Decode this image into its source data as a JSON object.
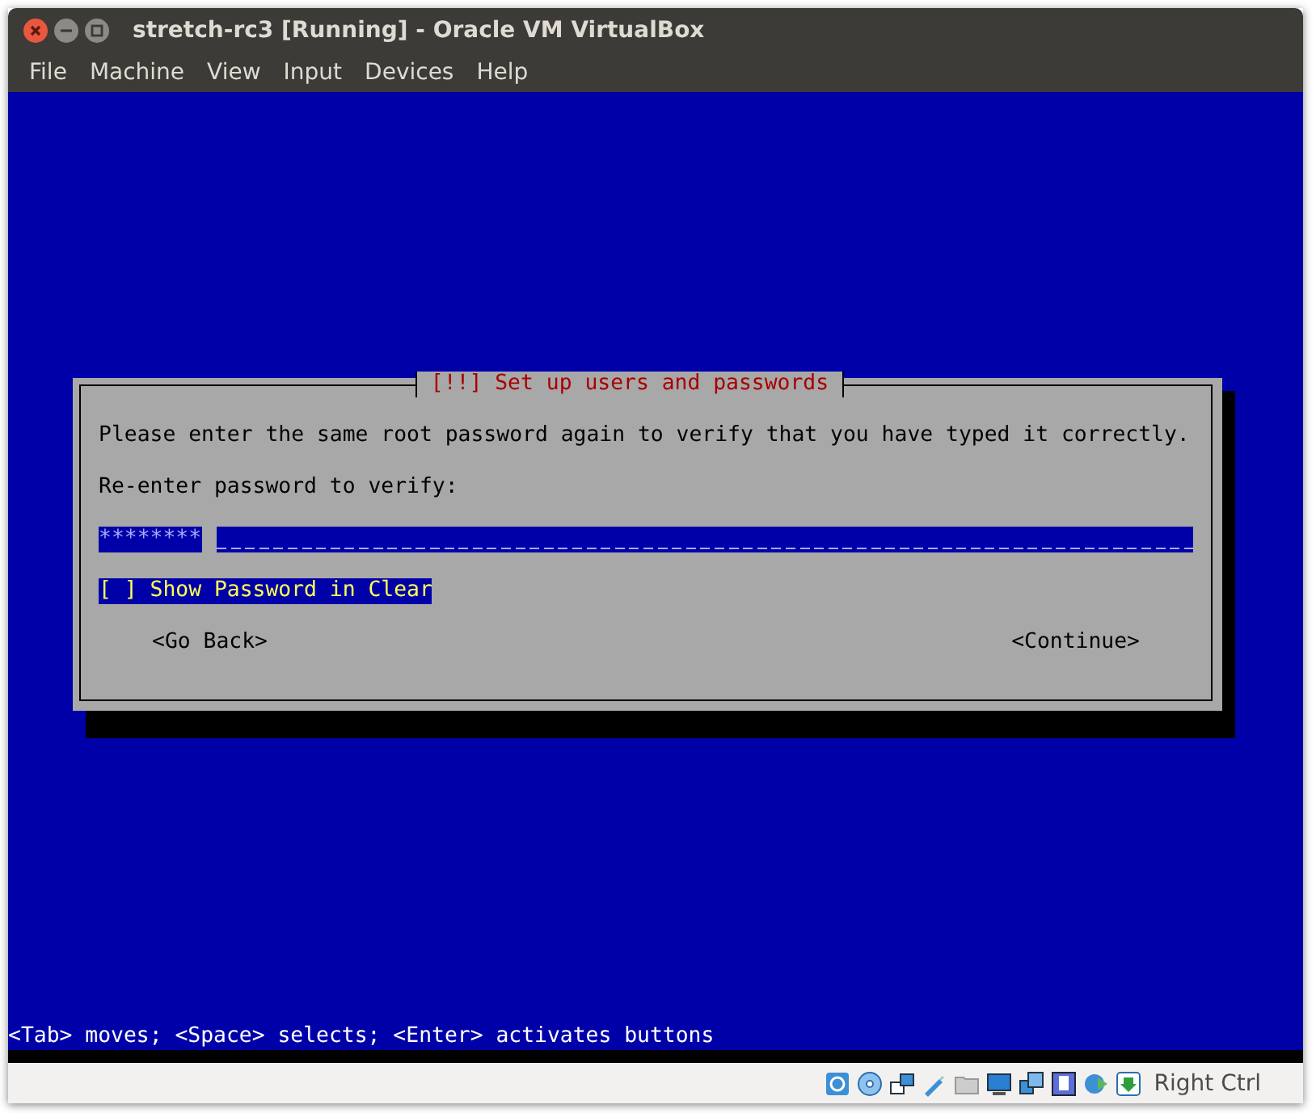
{
  "window": {
    "title": "stretch-rc3 [Running] - Oracle VM VirtualBox"
  },
  "menu": [
    "File",
    "Machine",
    "View",
    "Input",
    "Devices",
    "Help"
  ],
  "dialog": {
    "title": "[!!] Set up users and passwords",
    "message": "Please enter the same root password again to verify that you have typed it correctly.",
    "prompt": "Re-enter password to verify:",
    "password_field": {
      "value": "********"
    },
    "show_password": {
      "box": "[ ]",
      "label": "Show Password in Clear",
      "selected": true
    },
    "buttons": [
      {
        "label": "<Go Back>"
      },
      {
        "label": "<Continue>"
      }
    ]
  },
  "hint": "<Tab> moves; <Space> selects; <Enter> activates buttons",
  "status_bar": {
    "host_key": "Right Ctrl"
  }
}
